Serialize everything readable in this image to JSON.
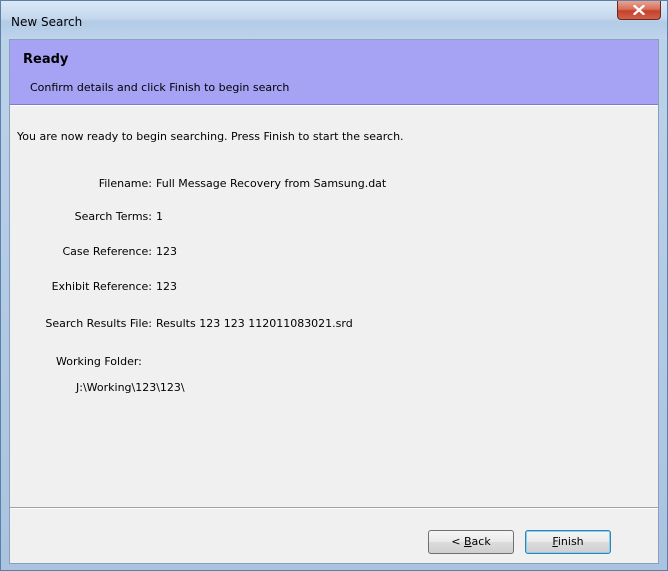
{
  "window": {
    "title": "New Search"
  },
  "header": {
    "title": "Ready",
    "subtitle": "Confirm details and click Finish to begin search"
  },
  "intro": "You are now ready to begin searching.  Press Finish to start the search.",
  "details": [
    {
      "label": "Filename:",
      "value": "Full Message Recovery from Samsung.dat"
    },
    {
      "label": "Search Terms:",
      "value": "1"
    },
    {
      "label": "Case Reference:",
      "value": "123"
    },
    {
      "label": "Exhibit Reference:",
      "value": "123"
    },
    {
      "label": "Search Results File:",
      "value": "Results 123 123 112011083021.srd"
    }
  ],
  "working_folder": {
    "label": "Working Folder:",
    "value": "J:\\Working\\123\\123\\"
  },
  "buttons": {
    "back_prefix": "< ",
    "back_mnemonic": "B",
    "back_rest": "ack",
    "finish_mnemonic": "F",
    "finish_rest": "inish"
  }
}
